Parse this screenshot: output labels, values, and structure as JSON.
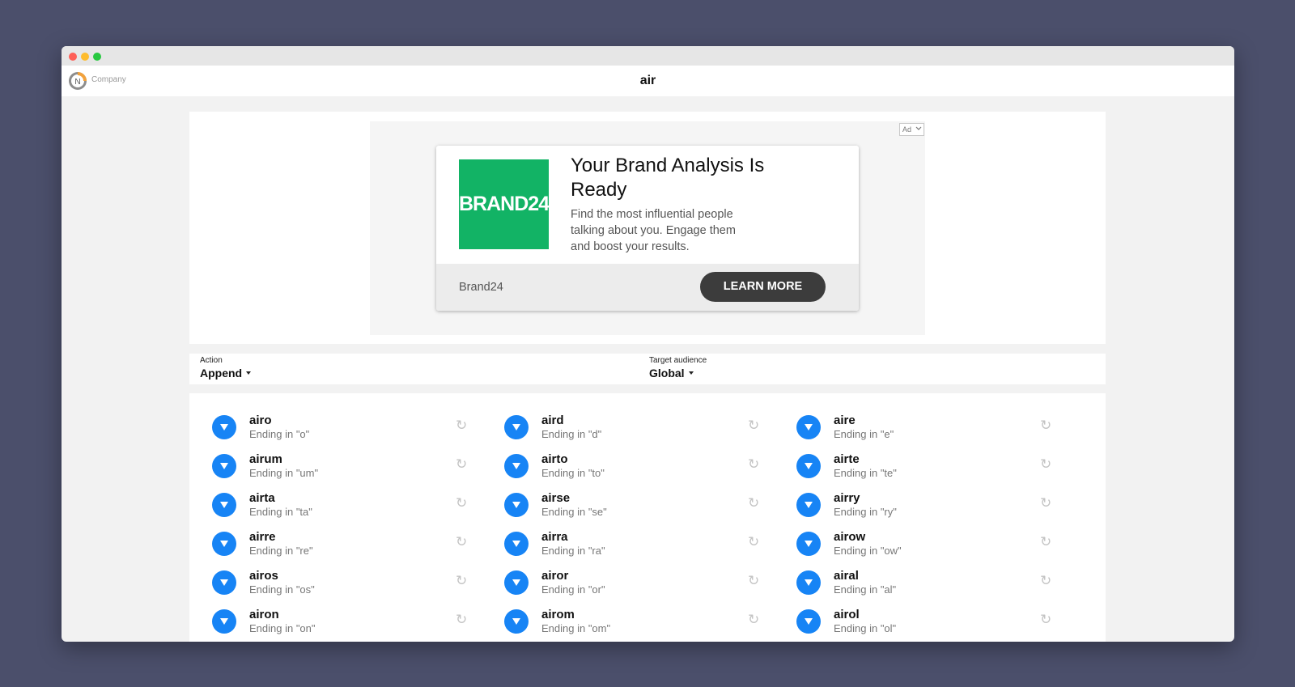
{
  "window": {
    "controls": [
      "close",
      "minimize",
      "zoom"
    ]
  },
  "appbar": {
    "company": "Company",
    "title": "air"
  },
  "ad": {
    "badge": "Ad",
    "badge_icon": "chevron-down-icon",
    "logo_text": "BRAND24",
    "headline": "Your Brand Analysis Is Ready",
    "description": "Find the most influential people talking about you. Engage them and boost your results.",
    "advertiser": "Brand24",
    "cta": "LEARN MORE",
    "brand_color": "#12b365"
  },
  "filters": {
    "action": {
      "label": "Action",
      "value": "Append"
    },
    "audience": {
      "label": "Target audience",
      "value": "Global"
    }
  },
  "results": {
    "accent": "#1784f5",
    "button_icon": "triangle-down-icon",
    "refresh_icon": "refresh-icon",
    "columns": [
      [
        {
          "word": "airo",
          "sub": "Ending in \"o\""
        },
        {
          "word": "airum",
          "sub": "Ending in \"um\""
        },
        {
          "word": "airta",
          "sub": "Ending in \"ta\""
        },
        {
          "word": "airre",
          "sub": "Ending in \"re\""
        },
        {
          "word": "airos",
          "sub": "Ending in \"os\""
        },
        {
          "word": "airon",
          "sub": "Ending in \"on\""
        }
      ],
      [
        {
          "word": "aird",
          "sub": "Ending in \"d\""
        },
        {
          "word": "airto",
          "sub": "Ending in \"to\""
        },
        {
          "word": "airse",
          "sub": "Ending in \"se\""
        },
        {
          "word": "airra",
          "sub": "Ending in \"ra\""
        },
        {
          "word": "airor",
          "sub": "Ending in \"or\""
        },
        {
          "word": "airom",
          "sub": "Ending in \"om\""
        }
      ],
      [
        {
          "word": "aire",
          "sub": "Ending in \"e\""
        },
        {
          "word": "airte",
          "sub": "Ending in \"te\""
        },
        {
          "word": "airry",
          "sub": "Ending in \"ry\""
        },
        {
          "word": "airow",
          "sub": "Ending in \"ow\""
        },
        {
          "word": "airal",
          "sub": "Ending in \"al\""
        },
        {
          "word": "airol",
          "sub": "Ending in \"ol\""
        }
      ]
    ]
  }
}
